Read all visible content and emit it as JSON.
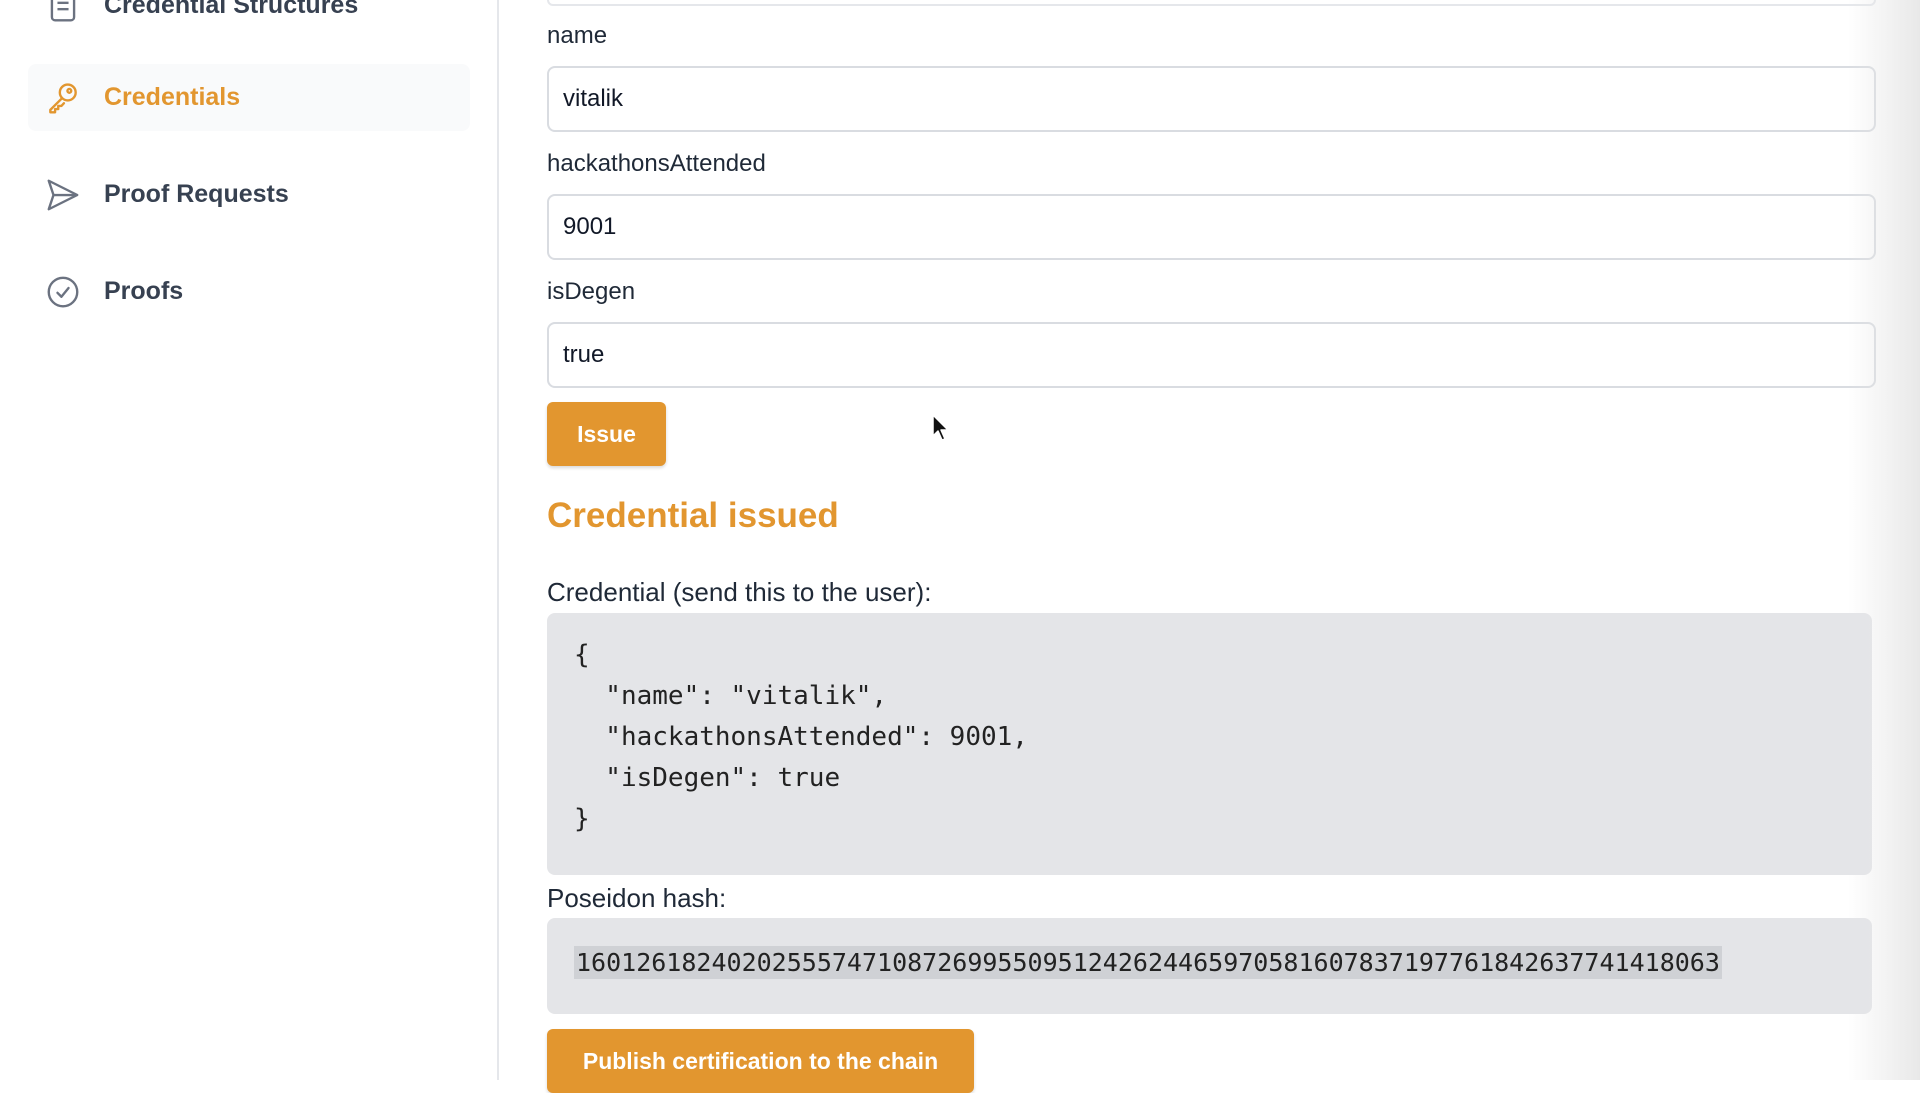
{
  "sidebar": {
    "items": [
      {
        "label": "Credential Structures",
        "icon": "document-icon",
        "active": false
      },
      {
        "label": "Credentials",
        "icon": "key-icon",
        "active": true
      },
      {
        "label": "Proof Requests",
        "icon": "send-icon",
        "active": false
      },
      {
        "label": "Proofs",
        "icon": "check-circle-icon",
        "active": false
      }
    ]
  },
  "form": {
    "fields": [
      {
        "label": "name",
        "value": "vitalik"
      },
      {
        "label": "hackathonsAttended",
        "value": "9001"
      },
      {
        "label": "isDegen",
        "value": "true"
      }
    ],
    "issue_button": "Issue"
  },
  "result": {
    "heading": "Credential issued",
    "credential_label": "Credential (send this to the user):",
    "credential_json": "{\n  \"name\": \"vitalik\",\n  \"hackathonsAttended\": 9001,\n  \"isDegen\": true\n}",
    "hash_label": "Poseidon hash:",
    "hash_value": "16012618240202555747108726995509512426244659705816078371977618426377414180 63",
    "publish_button": "Publish certification to the chain"
  },
  "colors": {
    "accent": "#e2962f",
    "code_bg": "#e4e5e8",
    "border": "#d9dce1"
  }
}
